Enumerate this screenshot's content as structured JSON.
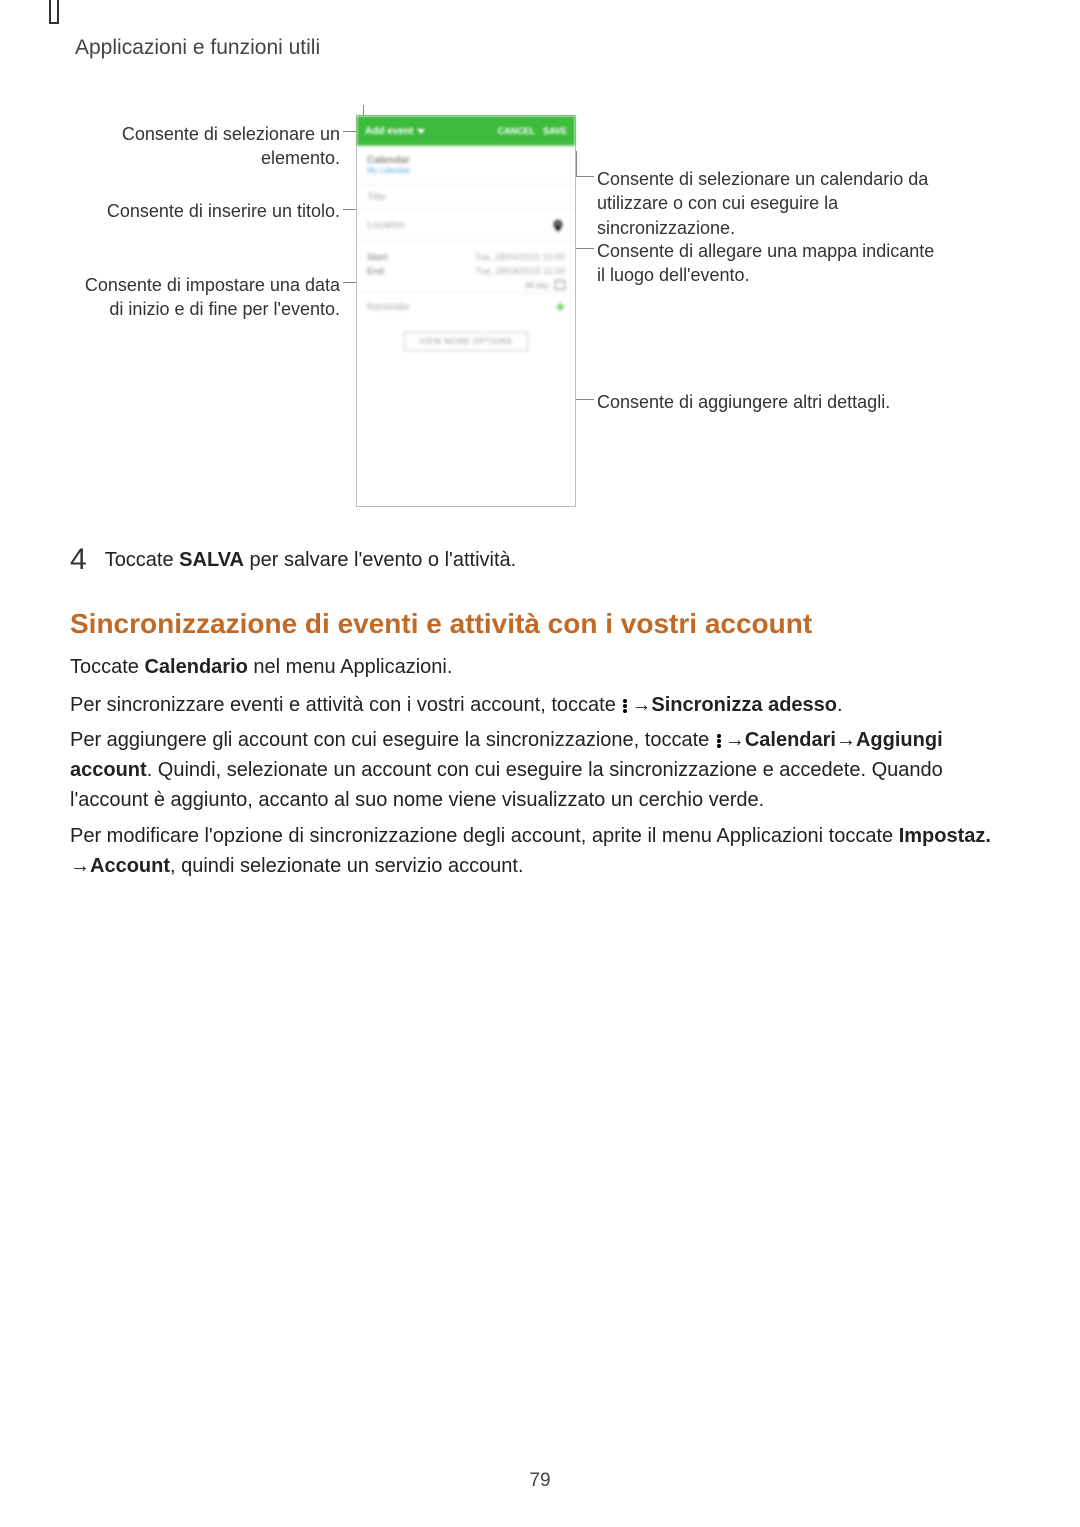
{
  "header": {
    "title": "Applicazioni e funzioni utili"
  },
  "figure": {
    "phone": {
      "topbar": {
        "add_event": "Add event",
        "cancel": "CANCEL",
        "save": "SAVE"
      },
      "calendar_row": {
        "line1": "Calendar",
        "line2": "My calendar"
      },
      "title_row": "Title",
      "location_row": "Location",
      "dates": {
        "start_label": "Start",
        "start_value": "Tue, 28/04/2015   10:00",
        "end_label": "End",
        "end_value": "Tue, 28/04/2015   11:00",
        "allday": "All day"
      },
      "reminder_row": "Reminder",
      "view_more": "VIEW MORE OPTIONS"
    },
    "callouts": {
      "left_dropdown": "Consente di selezionare un elemento.",
      "left_title": "Consente di inserire un titolo.",
      "left_dates": "Consente di impostare una data di inizio e di fine per l'evento.",
      "right_calendar": "Consente di selezionare un calendario da utilizzare o con cui eseguire la sincronizzazione.",
      "right_location": "Consente di allegare una mappa indicante il luogo dell'evento.",
      "right_viewmore": "Consente di aggiungere altri dettagli."
    }
  },
  "step4": {
    "number": "4",
    "pre": "Toccate ",
    "bold": "SALVA",
    "post": " per salvare l'evento o l'attività."
  },
  "section_heading": "Sincronizzazione di eventi e attività con i vostri account",
  "p1": {
    "pre": "Toccate ",
    "bold": "Calendario",
    "post": " nel menu Applicazioni."
  },
  "p2": {
    "pre": "Per sincronizzare eventi e attività con i vostri account, toccate ",
    "arrow": " → ",
    "bold": "Sincronizza adesso",
    "post": "."
  },
  "p3": {
    "pre": "Per aggiungere gli account con cui eseguire la sincronizzazione, toccate ",
    "arrow": " → ",
    "b1": "Calendari",
    "b2": "Aggiungi account",
    "post": ". Quindi, selezionate un account con cui eseguire la sincronizzazione e accedete. Quando l'account è aggiunto, accanto al suo nome viene visualizzato un cerchio verde."
  },
  "p4": {
    "pre": "Per modificare l'opzione di sincronizzazione degli account, aprite il menu Applicazioni toccate ",
    "b1": "Impostaz.",
    "arrow": " → ",
    "b2": "Account",
    "post": ", quindi selezionate un servizio account."
  },
  "page_number": "79"
}
